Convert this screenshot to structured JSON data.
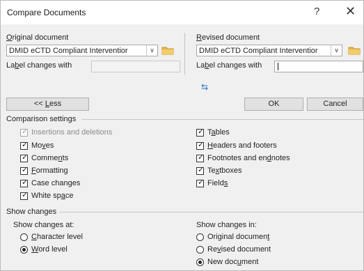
{
  "dialog": {
    "title": "Compare Documents",
    "help_glyph": "?",
    "close_glyph": "✕"
  },
  "original": {
    "label": "Original document",
    "value": "DMID eCTD Compliant Interventior",
    "label_changes": "Label changes with",
    "label_changes_value": ""
  },
  "revised": {
    "label": "Revised document",
    "value": "DMID eCTD Compliant Interventior",
    "label_changes": "Label changes with",
    "label_changes_value": ""
  },
  "swap_glyph": "⇆",
  "buttons": {
    "less": "<< Less",
    "ok": "OK",
    "cancel": "Cancel"
  },
  "comparison_settings": {
    "heading": "Comparison settings",
    "left": [
      {
        "label": "Insertions and deletions",
        "checked": true,
        "disabled": true
      },
      {
        "label": "Moves",
        "checked": true
      },
      {
        "label": "Comments",
        "checked": true
      },
      {
        "label": "Formatting",
        "checked": true
      },
      {
        "label": "Case changes",
        "checked": true
      },
      {
        "label": "White space",
        "checked": true
      }
    ],
    "right": [
      {
        "label": "Tables",
        "checked": true
      },
      {
        "label": "Headers and footers",
        "checked": true
      },
      {
        "label": "Footnotes and endnotes",
        "checked": true
      },
      {
        "label": "Textboxes",
        "checked": true
      },
      {
        "label": "Fields",
        "checked": true
      }
    ]
  },
  "show_changes": {
    "heading": "Show changes",
    "at_label": "Show changes at:",
    "at_options": [
      {
        "label": "Character level",
        "selected": false
      },
      {
        "label": "Word level",
        "selected": true
      }
    ],
    "in_label": "Show changes in:",
    "in_options": [
      {
        "label": "Original document",
        "selected": false
      },
      {
        "label": "Revised document",
        "selected": false
      },
      {
        "label": "New document",
        "selected": true
      }
    ]
  },
  "check_glyph": "✓",
  "colors": {
    "accent": "#2a6fc9",
    "folder": "#e8b548",
    "title_bg": "#ffffff",
    "dialog_bg": "#f0f0f0"
  }
}
